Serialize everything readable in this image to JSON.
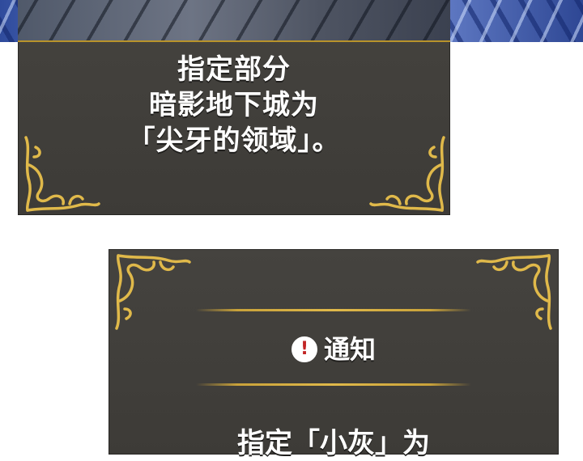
{
  "colors": {
    "panel": "#413f3b",
    "gold": "#e0b94a",
    "text": "#ffffff",
    "alert": "#c22424",
    "foliage": "#3a56a8"
  },
  "top_panel": {
    "lines": [
      "指定部分",
      "暗影地下城为",
      "「尖牙的领域」。"
    ]
  },
  "bottom_panel": {
    "icon": "exclamation-circle-icon",
    "alert_symbol": "!",
    "notice_label": "通知",
    "caption": "指定「小灰」为"
  }
}
